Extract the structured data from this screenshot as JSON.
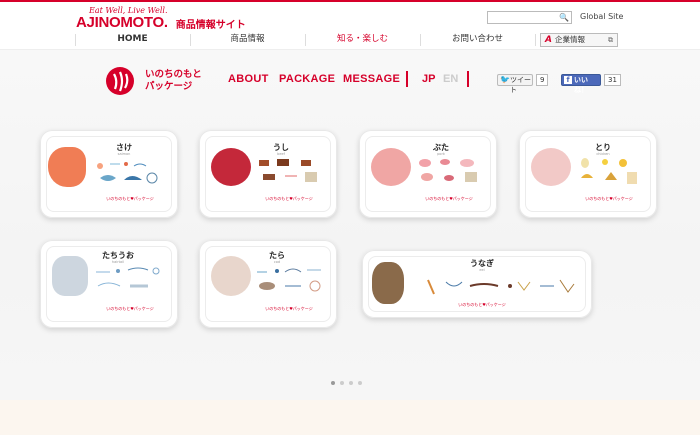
{
  "header": {
    "tagline": "Eat Well, Live Well.",
    "logo": "AJINOMOTO.",
    "site_name": "商品情報サイト",
    "search_button": "🔍",
    "global_site": "Global Site"
  },
  "nav": {
    "items": [
      {
        "label": "HOME"
      },
      {
        "label": "商品情報"
      },
      {
        "label": "知る・楽しむ"
      },
      {
        "label": "お問い合わせ"
      }
    ],
    "corporate": "企業情報",
    "corporate_mark": "A",
    "corporate_ext": "⧉"
  },
  "project": {
    "title_line1": "いのちのもと",
    "title_line2": "パッケージ",
    "menu": [
      {
        "label": "ABOUT"
      },
      {
        "label": "PACKAGE"
      },
      {
        "label": "MESSAGE"
      }
    ],
    "lang_jp": "JP",
    "lang_en": "EN"
  },
  "social": {
    "tweet_label": "ツイート",
    "tweet_icon": "🐦",
    "tweet_count": "9",
    "like_label": "いいね！",
    "like_icon": "f",
    "like_count": "31"
  },
  "trays": [
    {
      "name": "さけ",
      "sub": "salmon",
      "foot": "いのちのもと♥パッケージ",
      "meat_color": "#f07d55",
      "accent": "#fcd1bd"
    },
    {
      "name": "うし",
      "sub": "beef",
      "foot": "いのちのもと♥パッケージ",
      "meat_color": "#c4283a",
      "accent": "#e69aa1"
    },
    {
      "name": "ぶた",
      "sub": "pork",
      "foot": "いのちのもと♥パッケージ",
      "meat_color": "#f0a6a4",
      "accent": "#fad9d6"
    },
    {
      "name": "とり",
      "sub": "chicken",
      "foot": "いのちのもと♥パッケージ",
      "meat_color": "#f2c9c7",
      "accent": "#fbe8e3"
    },
    {
      "name": "たちうお",
      "sub": "hairtail",
      "foot": "いのちのもと♥パッケージ",
      "meat_color": "#cdd6df",
      "accent": "#eef2f5"
    },
    {
      "name": "たら",
      "sub": "cod",
      "foot": "いのちのもと♥パッケージ",
      "meat_color": "#e8d6cc",
      "accent": "#f6ece5"
    },
    {
      "name": "うなぎ",
      "sub": "eel",
      "foot": "いのちのもと♥パッケージ",
      "meat_color": "#8a6a4a",
      "accent": "#c9ab86"
    }
  ],
  "carousel": {
    "count": 4,
    "active": 0
  }
}
